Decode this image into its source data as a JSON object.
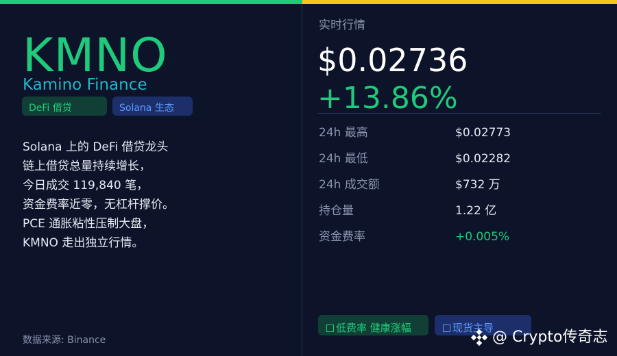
{
  "colors": {
    "accent_green": "#1ecb7c",
    "accent_yellow": "#f5c518",
    "accent_cyan": "#21b5c9",
    "accent_blue": "#5b9bff",
    "background": "#0d1329"
  },
  "coin": {
    "ticker": "KMNO",
    "name": "Kamino Finance",
    "tags": [
      "DeFi 借贷",
      "Solana 生态"
    ]
  },
  "description": [
    "Solana 上的 DeFi 借贷龙头",
    "链上借贷总量持续增长，",
    "今日成交 119,840 笔，",
    "资金费率近零，无杠杆撑价。",
    "PCE 通胀粘性压制大盘，",
    "KMNO 走出独立行情。"
  ],
  "source": "数据来源: Binance",
  "market": {
    "label": "实时行情",
    "price": "$0.02736",
    "change": "+13.86%",
    "stats": [
      {
        "label": "24h 最高",
        "value": "$0.02773"
      },
      {
        "label": "24h 最低",
        "value": "$0.02282"
      },
      {
        "label": "24h 成交额",
        "value": "$732 万"
      },
      {
        "label": "持仓量",
        "value": "1.22 亿"
      },
      {
        "label": "资金费率",
        "value": "+0.005%"
      }
    ]
  },
  "badges": {
    "first": "低费率 健康涨幅",
    "second": "现货主导",
    "check_icon": "check-box-icon"
  },
  "watermark": {
    "icon": "binance-logo-icon",
    "text": "@ Crypto传奇志"
  }
}
